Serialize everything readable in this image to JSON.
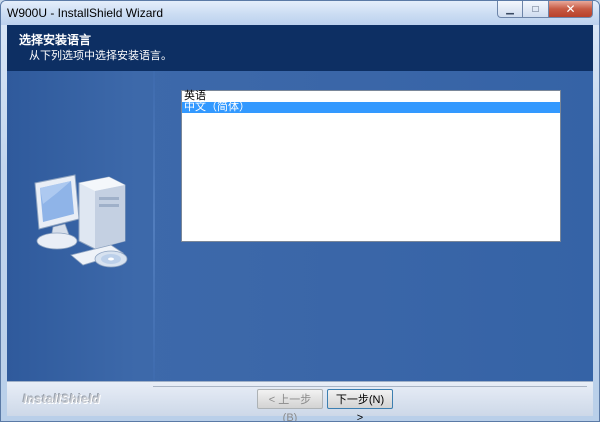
{
  "window": {
    "title": "W900U - InstallShield Wizard",
    "minimize_label": "▁",
    "maximize_label": "□",
    "close_label": "✕"
  },
  "header": {
    "title": "选择安装语言",
    "subtitle": "从下列选项中选择安装语言。"
  },
  "language_list": {
    "items": [
      {
        "label": "英语",
        "selected": false
      },
      {
        "label": "中文（简体）",
        "selected": true
      }
    ]
  },
  "footer": {
    "brand": "InstallShield",
    "back_label": "< 上一步(B)",
    "next_label": "下一步(N) >"
  },
  "colors": {
    "header_bg": "#0d2f63",
    "content_bg": "#3a66a8",
    "selection": "#3399ff"
  }
}
